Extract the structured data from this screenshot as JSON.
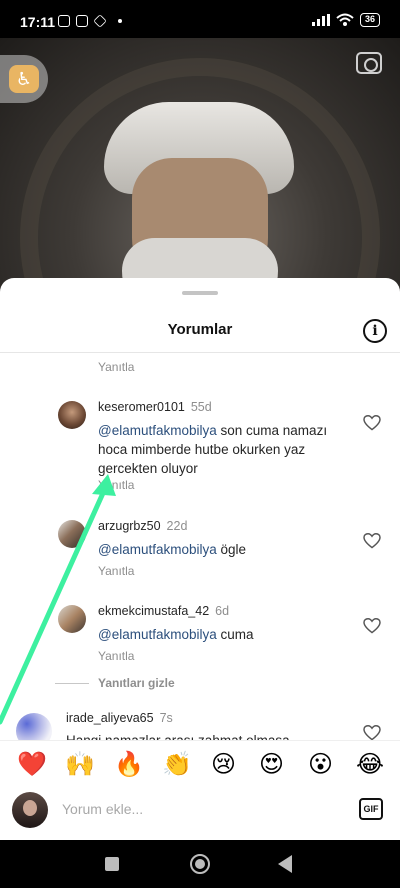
{
  "status_bar": {
    "time": "17:11",
    "battery": "36"
  },
  "sheet": {
    "title": "Yorumlar",
    "info_label": "i"
  },
  "comments": [
    {
      "reply_label": "Yanıtla"
    },
    {
      "username": "keseromer0101",
      "time": "55d",
      "mention": "@elamutfakmobilya",
      "text": " son cuma namazı hoca mimberde hutbe okurken yaz gercekten oluyor",
      "reply_label": "Yanıtla"
    },
    {
      "username": "arzugrbz50",
      "time": "22d",
      "mention": "@elamutfakmobilya",
      "text": " ögle",
      "reply_label": "Yanıtla"
    },
    {
      "username": "ekmekcimustafa_42",
      "time": "6d",
      "mention": "@elamutfakmobilya",
      "text": " cuma",
      "reply_label": "Yanıtla"
    },
    {
      "username": "irade_aliyeva65",
      "time": "7s",
      "text": "Hangi namazlar arası zahmat olmasa"
    }
  ],
  "hide_replies_label": "Yanıtları gizle",
  "emojis": [
    "❤️",
    "🙌",
    "🔥",
    "👏",
    "😢",
    "😍",
    "😮",
    "😂"
  ],
  "comment_input": {
    "placeholder": "Yorum ekle..."
  },
  "gif_label": "GIF",
  "colors": {
    "annotation_arrow": "#3df0a0",
    "mention": "#2c4f7c"
  }
}
